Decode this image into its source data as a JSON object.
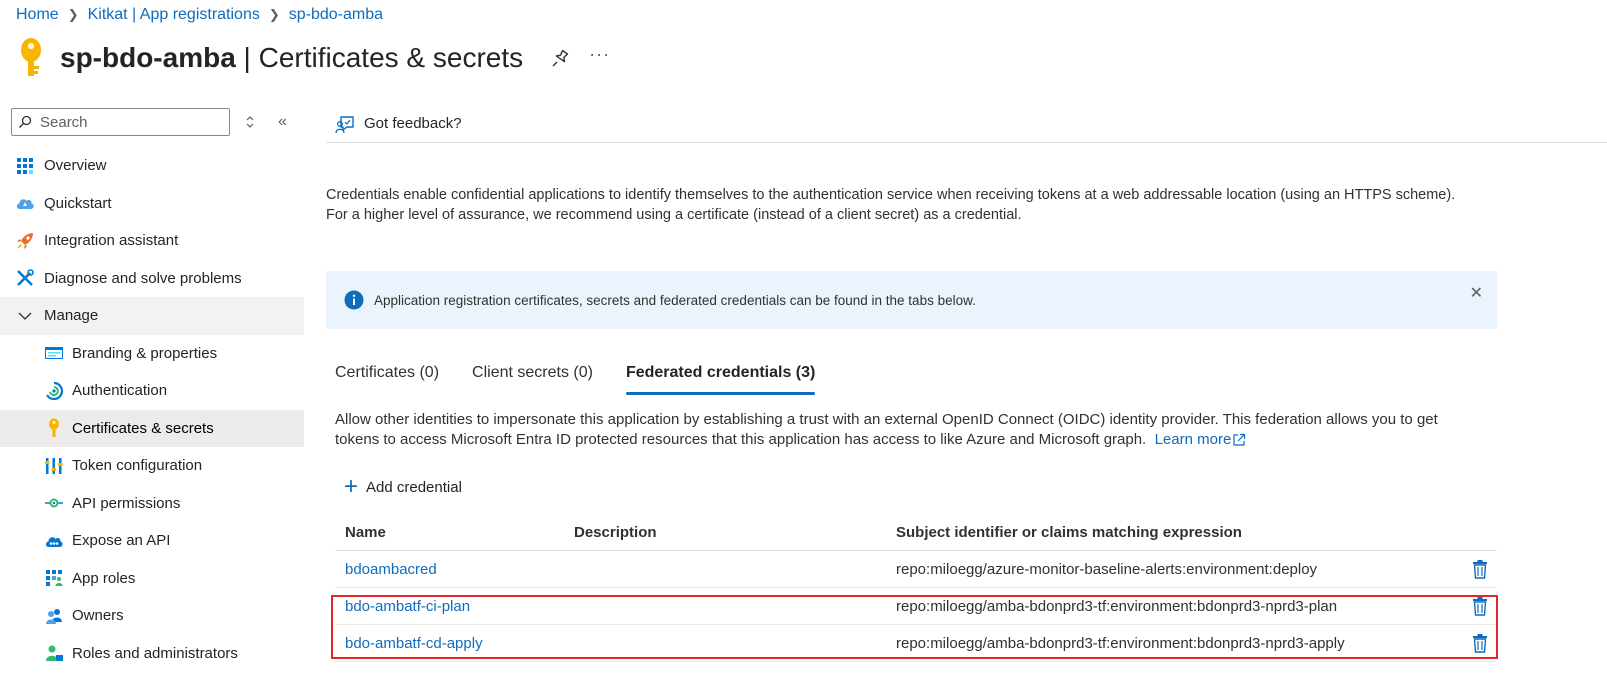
{
  "breadcrumb": [
    "Home",
    "Kitkat | App registrations",
    "sp-bdo-amba"
  ],
  "title": {
    "app_name": "sp-bdo-amba",
    "section": " | Certificates & secrets",
    "more": "···"
  },
  "sidebar": {
    "search_placeholder": "Search",
    "collapse": "«",
    "items": [
      {
        "label": "Overview",
        "icon": "grid-icon"
      },
      {
        "label": "Quickstart",
        "icon": "cloud-icon"
      },
      {
        "label": "Integration assistant",
        "icon": "rocket-icon"
      },
      {
        "label": "Diagnose and solve problems",
        "icon": "wrench-icon"
      },
      {
        "label": "Manage",
        "icon": "chevron-down-icon"
      },
      {
        "label": "Branding & properties",
        "icon": "branding-icon"
      },
      {
        "label": "Authentication",
        "icon": "authentication-icon"
      },
      {
        "label": "Certificates & secrets",
        "icon": "key-icon"
      },
      {
        "label": "Token configuration",
        "icon": "token-icon"
      },
      {
        "label": "API permissions",
        "icon": "api-permissions-icon"
      },
      {
        "label": "Expose an API",
        "icon": "cloud-api-icon"
      },
      {
        "label": "App roles",
        "icon": "app-roles-icon"
      },
      {
        "label": "Owners",
        "icon": "owners-icon"
      },
      {
        "label": "Roles and administrators",
        "icon": "roles-icon"
      }
    ]
  },
  "command_bar": {
    "feedback_label": "Got feedback?"
  },
  "intro_text": "Credentials enable confidential applications to identify themselves to the authentication service when receiving tokens at a web addressable location (using an HTTPS scheme). For a higher level of assurance, we recommend using a certificate (instead of a client secret) as a credential.",
  "info_bar": {
    "text": "Application registration certificates, secrets and federated credentials can be found in the tabs below.",
    "close": "✕"
  },
  "tabs": [
    {
      "label": "Certificates (0)",
      "active": false
    },
    {
      "label": "Client secrets (0)",
      "active": false
    },
    {
      "label": "Federated credentials (3)",
      "active": true
    }
  ],
  "federated": {
    "description": "Allow other identities to impersonate this application by establishing a trust with an external OpenID Connect (OIDC) identity provider. This federation allows you to get tokens to access Microsoft Entra ID protected resources that this application has access to like Azure and Microsoft graph.",
    "learn_more": "Learn more",
    "add_label": "Add credential",
    "columns": [
      "Name",
      "Description",
      "Subject identifier or claims matching expression"
    ],
    "rows": [
      {
        "name": "bdoambacred",
        "description": "",
        "subject": "repo:miloegg/azure-monitor-baseline-alerts:environment:deploy"
      },
      {
        "name": "bdo-ambatf-ci-plan",
        "description": "",
        "subject": "repo:miloegg/amba-bdonprd3-tf:environment:bdonprd3-nprd3-plan"
      },
      {
        "name": "bdo-ambatf-cd-apply",
        "description": "",
        "subject": "repo:miloegg/amba-bdonprd3-tf:environment:bdonprd3-nprd3-apply"
      }
    ]
  },
  "colors": {
    "accent": "#0f6cbd",
    "highlight": "#e3242b",
    "info_bg": "#ebf3fc"
  }
}
